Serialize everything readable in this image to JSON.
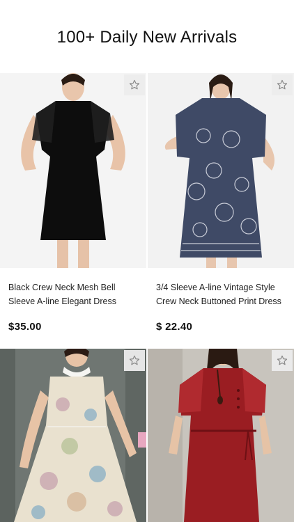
{
  "header": {
    "title": "100+ Daily New Arrivals"
  },
  "products": [
    {
      "title": "Black Crew Neck Mesh Bell Sleeve A-line Elegant Dress",
      "price": "$35.00",
      "favorite_icon": "star-outline-icon"
    },
    {
      "title": "3/4 Sleeve A-line Vintage Style Crew Neck Buttoned Print Dress",
      "price": "$ 22.40",
      "favorite_icon": "star-outline-icon"
    },
    {
      "title": "",
      "price": "",
      "favorite_icon": "star-outline-icon"
    },
    {
      "title": "",
      "price": "",
      "favorite_icon": "star-outline-icon"
    }
  ],
  "colors": {
    "background": "#ffffff",
    "text": "#111111",
    "fav_bg": "#ececec",
    "star": "#8a8a8a"
  }
}
